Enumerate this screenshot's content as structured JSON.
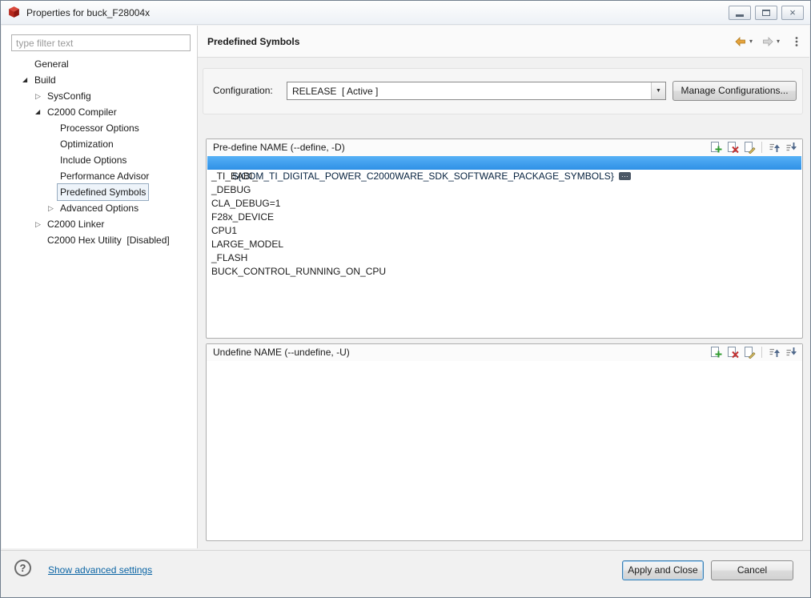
{
  "window": {
    "title": "Properties for buck_F28004x"
  },
  "icons": {
    "collapsed": "▷",
    "expanded": "◢",
    "dropdown_arrow": "▼",
    "nav_caret": "▾",
    "close": "×",
    "help": "?",
    "inline_edit": "···"
  },
  "sidebar": {
    "filter_placeholder": "type filter text",
    "tree": [
      {
        "label": "General"
      },
      {
        "label": "Build"
      },
      {
        "label": "SysConfig"
      },
      {
        "label": "C2000 Compiler"
      },
      {
        "label": "Processor Options"
      },
      {
        "label": "Optimization"
      },
      {
        "label": "Include Options"
      },
      {
        "label": "Performance Advisor"
      },
      {
        "label": "Predefined Symbols"
      },
      {
        "label": "Advanced Options"
      },
      {
        "label": "C2000 Linker"
      },
      {
        "label": "C2000 Hex Utility  [Disabled]"
      }
    ]
  },
  "header": {
    "title": "Predefined Symbols"
  },
  "config": {
    "label": "Configuration:",
    "selected": "RELEASE  [ Active ]",
    "manage_button": "Manage Configurations..."
  },
  "predefine": {
    "title": "Pre-define NAME (--define, -D)",
    "items": [
      "${COM_TI_DIGITAL_POWER_C2000WARE_SDK_SOFTWARE_PACKAGE_SYMBOLS}",
      "_TI_EABI_",
      "_DEBUG",
      "CLA_DEBUG=1",
      "F28x_DEVICE",
      "CPU1",
      "LARGE_MODEL",
      "_FLASH",
      "BUCK_CONTROL_RUNNING_ON_CPU"
    ]
  },
  "undefine": {
    "title": "Undefine NAME (--undefine, -U)"
  },
  "footer": {
    "link": "Show advanced settings",
    "apply": "Apply and Close",
    "cancel": "Cancel"
  }
}
